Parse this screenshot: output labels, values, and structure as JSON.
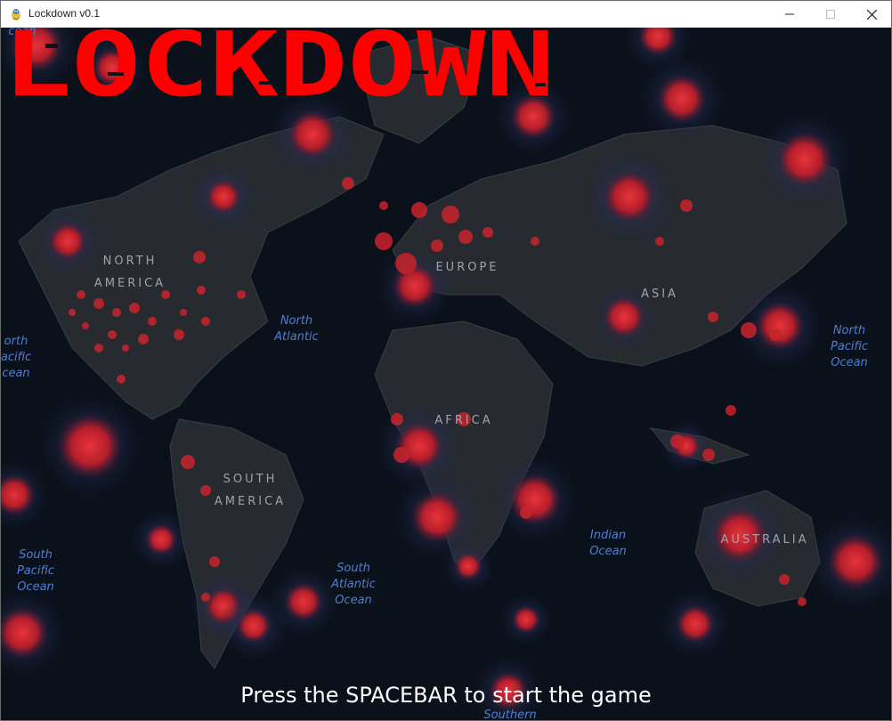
{
  "window": {
    "title": "Lockdown v0.1",
    "controls": {
      "minimize": "—",
      "maximize": "☐",
      "close": "✕"
    }
  },
  "game": {
    "title": "LOCKDOWN",
    "start_prompt": "Press the SPACEBAR to start the game",
    "title_color": "#ff0000",
    "background_color": "#0a111a",
    "virus_color": "#c8232b"
  },
  "map": {
    "continents": [
      {
        "name": "north-america",
        "label": "NORTH\nAMERICA"
      },
      {
        "name": "europe",
        "label": "EUROPE"
      },
      {
        "name": "asia",
        "label": "ASIA"
      },
      {
        "name": "africa",
        "label": "AFRICA"
      },
      {
        "name": "south-america",
        "label": "SOUTH\nAMERICA"
      },
      {
        "name": "australia",
        "label": "AUSTRALIA"
      }
    ],
    "oceans": [
      {
        "name": "north-atlantic",
        "label": "North\nAtlantic"
      },
      {
        "name": "north-pacific-left",
        "label": "orth\nacific\ncean"
      },
      {
        "name": "north-pacific-right",
        "label": "North\nPacific\nOcean"
      },
      {
        "name": "south-pacific",
        "label": "South\nPacific\nOcean"
      },
      {
        "name": "south-atlantic",
        "label": "South\nAtlantic\nOcean"
      },
      {
        "name": "indian",
        "label": "Indian\nOcean"
      },
      {
        "name": "southern",
        "label": "Southern"
      },
      {
        "name": "arctic",
        "label": "cean"
      }
    ]
  }
}
